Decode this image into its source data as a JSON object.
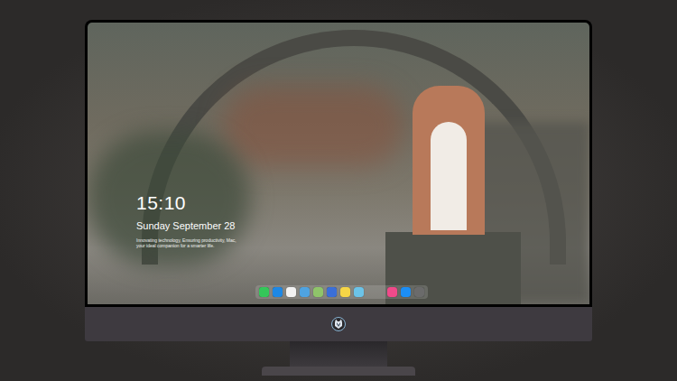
{
  "screen": {
    "clock": {
      "time": "15:10",
      "date": "Sunday September 28",
      "tagline": "Innovating technology, Ensuring productivity, Mac, your ideal companion for a smarter life."
    }
  },
  "dock": {
    "apps": [
      {
        "color": "#34c759"
      },
      {
        "color": "#1e88e5"
      },
      {
        "color": "#f2f2f2"
      },
      {
        "color": "#4fa3e0"
      },
      {
        "color": "#8fc46a"
      },
      {
        "color": "#3b6fd8"
      },
      {
        "color": "#f5d547"
      },
      {
        "color": "#6cc3e8"
      },
      {
        "color": "#f04a8a"
      },
      {
        "color": "#1c8ef5"
      },
      {
        "color": "#6b6b6b"
      }
    ]
  }
}
